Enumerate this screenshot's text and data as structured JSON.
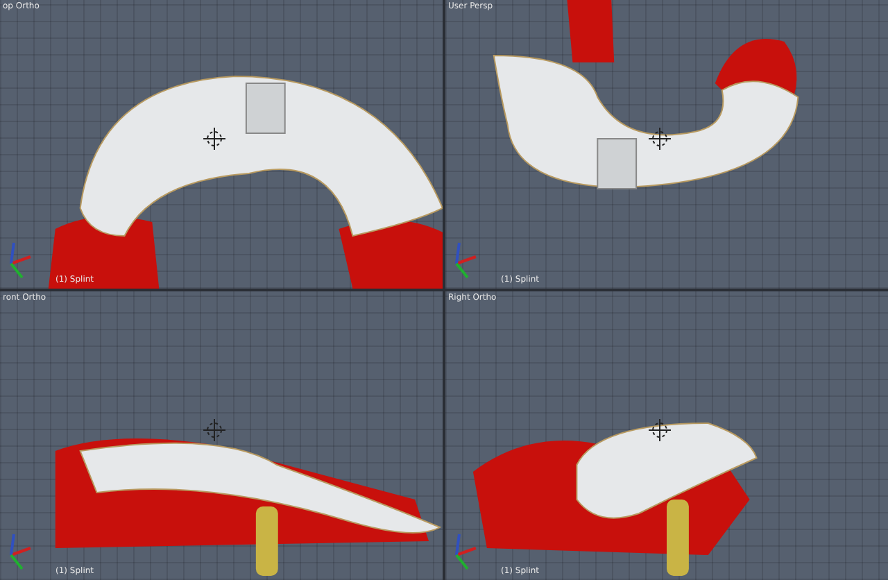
{
  "viewports": [
    {
      "title": "op Ortho",
      "object_label": "(1) Splint",
      "kind": "top"
    },
    {
      "title": "User Persp",
      "object_label": "(1) Splint",
      "kind": "persp"
    },
    {
      "title": "ront Ortho",
      "object_label": "(1) Splint",
      "kind": "front"
    },
    {
      "title": "Right Ortho",
      "object_label": "(1) Splint",
      "kind": "right"
    }
  ]
}
